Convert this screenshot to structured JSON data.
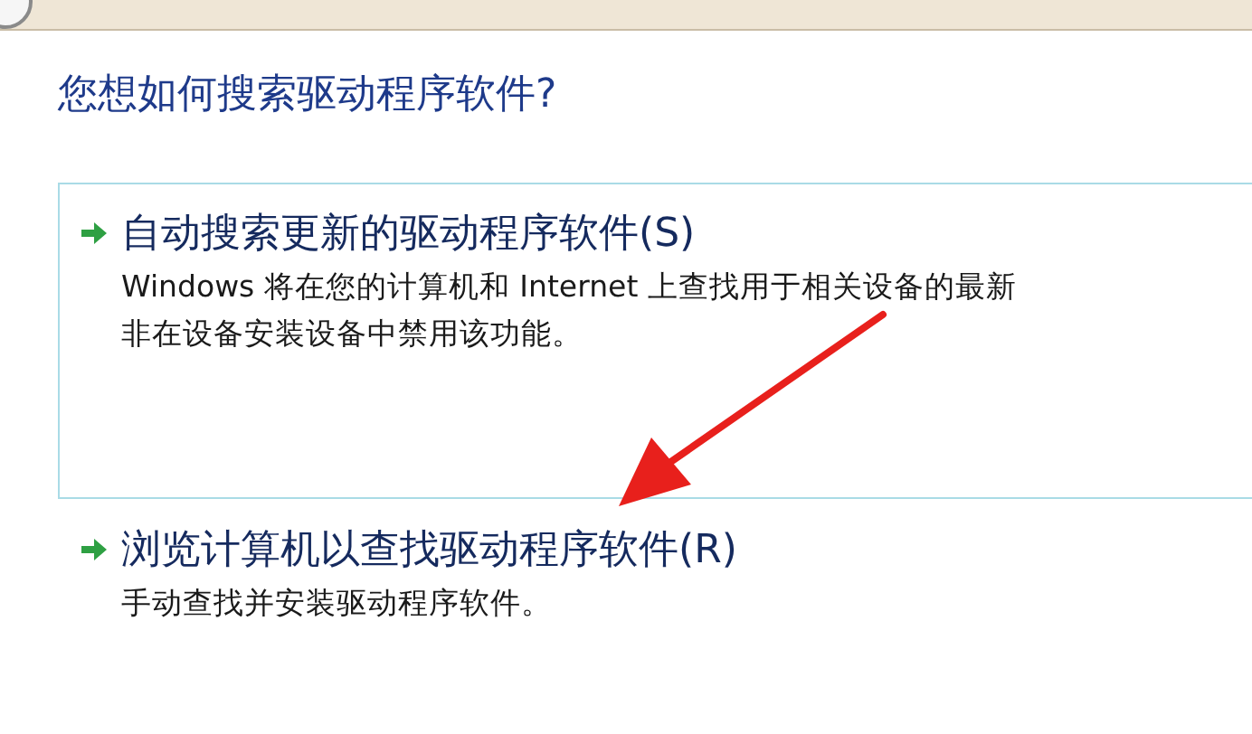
{
  "heading": "您想如何搜索驱动程序软件?",
  "options": [
    {
      "title": "自动搜索更新的驱动程序软件(S)",
      "description": [
        "Windows 将在您的计算机和 Internet 上查找用于相关设备的最新",
        "非在设备安装设备中禁用该功能。"
      ],
      "selected": true
    },
    {
      "title": "浏览计算机以查找驱动程序软件(R)",
      "description": [
        "手动查找并安装驱动程序软件。"
      ],
      "selected": false
    }
  ]
}
